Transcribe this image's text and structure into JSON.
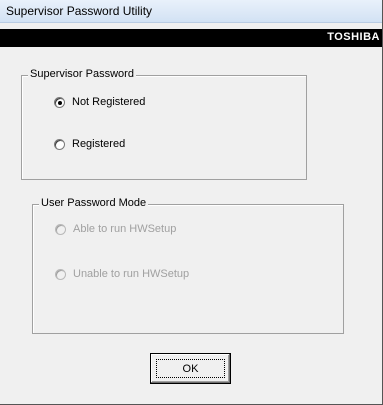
{
  "window": {
    "title": "Supervisor Password Utility"
  },
  "brand": {
    "text": "TOSHIBA"
  },
  "supervisor_group": {
    "legend": "Supervisor Password",
    "options": [
      {
        "label": "Not Registered",
        "checked": true
      },
      {
        "label": "Registered",
        "checked": false
      }
    ]
  },
  "user_mode_group": {
    "legend": "User Password Mode",
    "disabled": true,
    "options": [
      {
        "label": "Able to run HWSetup",
        "checked": false
      },
      {
        "label": "Unable to run HWSetup",
        "checked": false
      }
    ]
  },
  "buttons": {
    "ok_label": "OK"
  }
}
